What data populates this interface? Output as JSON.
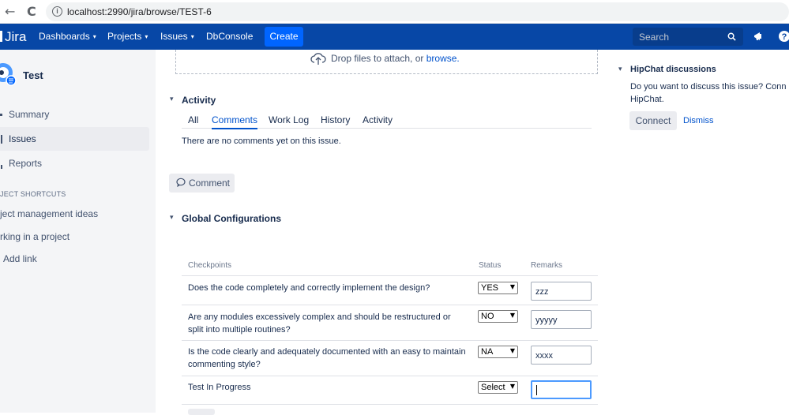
{
  "browser": {
    "back": "←",
    "forward": "→",
    "reload": "C",
    "url": "localhost:2990/jira/browse/TEST-6"
  },
  "header": {
    "logo": "Jira",
    "menus": [
      "Dashboards",
      "Projects",
      "Issues"
    ],
    "dbconsole": "DbConsole",
    "create_label": "Create",
    "search_placeholder": "Search",
    "caret": "▾",
    "icons": [
      "search-icon",
      "notifications-icon",
      "help-icon"
    ]
  },
  "sidebar": {
    "project_name": "Test",
    "items": [
      {
        "label": "Summary",
        "active": false
      },
      {
        "label": "Issues",
        "active": true
      },
      {
        "label": "Reports",
        "active": false
      }
    ],
    "shortcuts_heading": "JECT SHORTCUTS",
    "shortcuts": [
      "ject management ideas",
      "rking in a project"
    ],
    "add_link": "Add link"
  },
  "attachments": {
    "drop_text": "Drop files to attach, or ",
    "browse_link": "browse."
  },
  "activity": {
    "toggle": "▾",
    "title": "Activity",
    "tabs": [
      "All",
      "Comments",
      "Work Log",
      "History",
      "Activity"
    ],
    "active_tab": "Comments",
    "empty_message": "There are no comments yet on this issue.",
    "comment_button": "Comment"
  },
  "global_config": {
    "title": "Global Configurations",
    "columns": [
      "Checkpoints",
      "Status",
      "Remarks"
    ],
    "rows": [
      {
        "question": "Does the code completely and correctly implement the design?",
        "status": "YES",
        "remark": "zzz"
      },
      {
        "question": "Are any modules excessively complex and should be restructured or split into multiple routines?",
        "status": "NO",
        "remark": "yyyyy"
      },
      {
        "question": "Is the code clearly and adequately documented with an easy to maintain commenting style?",
        "status": "NA",
        "remark": "xxxx"
      },
      {
        "question": "Test In Progress",
        "status": "Select",
        "remark": ""
      }
    ],
    "select_caret": "▼"
  },
  "hipchat": {
    "toggle": "▾",
    "title": "HipChat discussions",
    "description_line1": "Do you want to discuss this issue? Conn",
    "description_line2": "HipChat.",
    "connect_label": "Connect",
    "dismiss_label": "Dismiss"
  },
  "colors": {
    "header_bg": "#0747a6",
    "create_bg": "#0065ff",
    "link": "#0052cc",
    "sidebar_bg": "#f4f5f7"
  }
}
